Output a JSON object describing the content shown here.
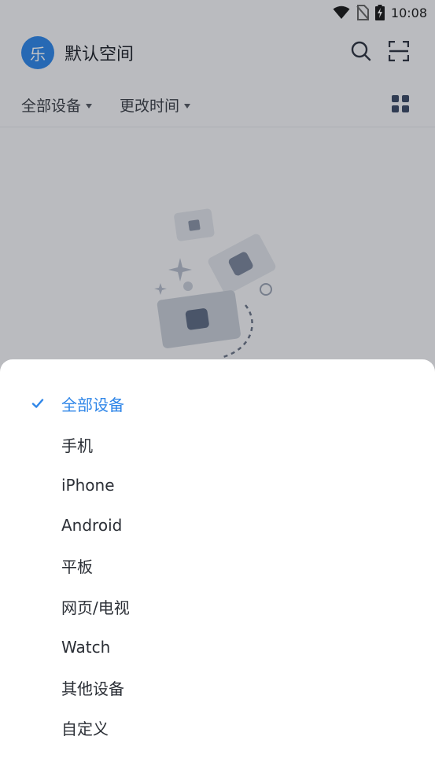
{
  "status_bar": {
    "time": "10:08",
    "icons": [
      "wifi-icon",
      "no-sim-icon",
      "battery-charging-icon"
    ]
  },
  "header": {
    "avatar_text": "乐",
    "title": "默认空间",
    "actions": [
      "search-icon",
      "scan-icon"
    ]
  },
  "filters": {
    "device_filter": "全部设备",
    "sort_filter": "更改时间",
    "view_toggle": "grid-view-icon"
  },
  "sheet": {
    "options": [
      {
        "label": "全部设备",
        "selected": true
      },
      {
        "label": "手机",
        "selected": false
      },
      {
        "label": "iPhone",
        "selected": false
      },
      {
        "label": "Android",
        "selected": false
      },
      {
        "label": "平板",
        "selected": false
      },
      {
        "label": "网页/电视",
        "selected": false
      },
      {
        "label": "Watch",
        "selected": false
      },
      {
        "label": "其他设备",
        "selected": false
      },
      {
        "label": "自定义",
        "selected": false
      }
    ]
  },
  "colors": {
    "accent": "#2f86e8",
    "text_primary": "#1d2129",
    "overlay": "rgba(20,22,30,0.26)"
  }
}
